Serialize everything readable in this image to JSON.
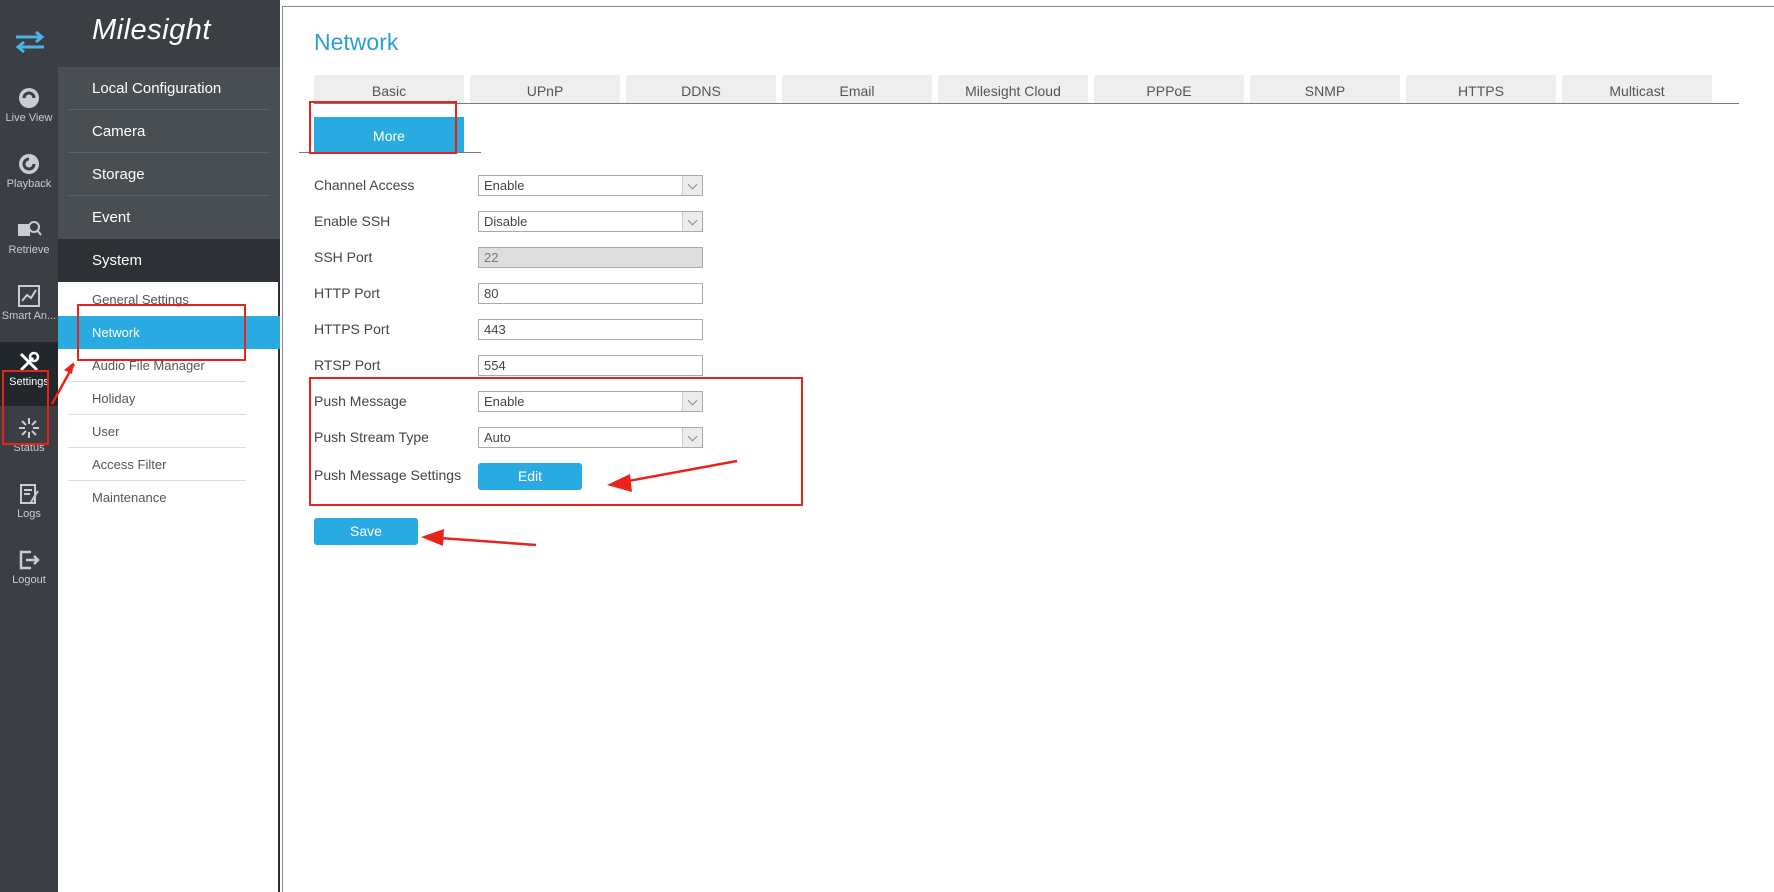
{
  "rail": {
    "items": [
      {
        "label": "Live View",
        "icon": "live-view-icon"
      },
      {
        "label": "Playback",
        "icon": "playback-icon"
      },
      {
        "label": "Retrieve",
        "icon": "retrieve-icon"
      },
      {
        "label": "Smart An...",
        "icon": "smart-analysis-icon"
      },
      {
        "label": "Settings",
        "icon": "settings-icon"
      },
      {
        "label": "Status",
        "icon": "status-icon"
      },
      {
        "label": "Logs",
        "icon": "logs-icon"
      },
      {
        "label": "Logout",
        "icon": "logout-icon"
      }
    ]
  },
  "brand": {
    "logo_text": "Milesight"
  },
  "menu": {
    "categories": [
      "Local Configuration",
      "Camera",
      "Storage",
      "Event",
      "System"
    ],
    "system_items": [
      "General Settings",
      "Network",
      "Audio File Manager",
      "Holiday",
      "User",
      "Access Filter",
      "Maintenance"
    ]
  },
  "page": {
    "title": "Network",
    "tabs": [
      "Basic",
      "UPnP",
      "DDNS",
      "Email",
      "Milesight Cloud",
      "PPPoE",
      "SNMP",
      "HTTPS",
      "Multicast"
    ],
    "active_tab": "More"
  },
  "form": {
    "channel_access": {
      "label": "Channel Access",
      "value": "Enable"
    },
    "enable_ssh": {
      "label": "Enable SSH",
      "value": "Disable"
    },
    "ssh_port": {
      "label": "SSH Port",
      "value": "22"
    },
    "http_port": {
      "label": "HTTP Port",
      "value": "80"
    },
    "https_port": {
      "label": "HTTPS Port",
      "value": "443"
    },
    "rtsp_port": {
      "label": "RTSP Port",
      "value": "554"
    },
    "push_message": {
      "label": "Push Message",
      "value": "Enable"
    },
    "push_stream_type": {
      "label": "Push Stream Type",
      "value": "Auto"
    },
    "push_message_settings": {
      "label": "Push Message Settings",
      "button": "Edit"
    },
    "save_button": "Save"
  },
  "colors": {
    "accent": "#29abe2",
    "rail_bg": "#3b3f44",
    "annotation": "#e8231c"
  }
}
